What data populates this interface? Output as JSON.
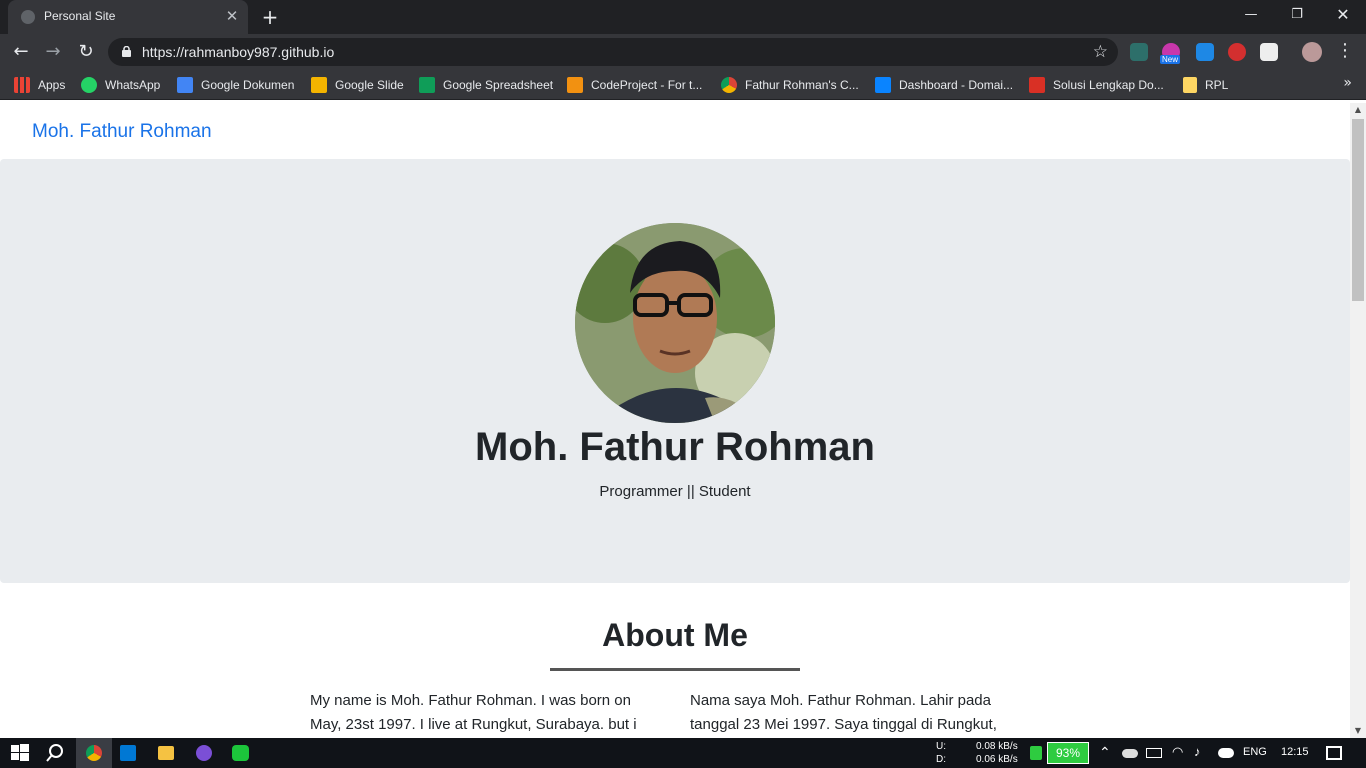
{
  "browser": {
    "tab_title": "Personal Site",
    "url": "https://rahmanboy987.github.io",
    "ext_badge": "New"
  },
  "bookmarks": [
    {
      "label": "Apps",
      "icon": "apps-grid-icon",
      "color": "#ea4335"
    },
    {
      "label": "WhatsApp",
      "icon": "whatsapp-icon",
      "color": "#25d366"
    },
    {
      "label": "Google Dokumen",
      "icon": "google-docs-icon",
      "color": "#4285f4"
    },
    {
      "label": "Google Slide",
      "icon": "google-slides-icon",
      "color": "#f4b400"
    },
    {
      "label": "Google Spreadsheet",
      "icon": "google-sheets-icon",
      "color": "#0f9d58"
    },
    {
      "label": "CodeProject - For t...",
      "icon": "codeproject-icon",
      "color": "#f29111"
    },
    {
      "label": "Fathur Rohman's C...",
      "icon": "chrome-icon",
      "color": "#db4437"
    },
    {
      "label": "Dashboard - Domai...",
      "icon": "domain-icon",
      "color": "#0a84ff"
    },
    {
      "label": "Solusi Lengkap Do...",
      "icon": "solusi-icon",
      "color": "#d93025"
    },
    {
      "label": "RPL",
      "icon": "folder-icon",
      "color": "#fdd663"
    }
  ],
  "site": {
    "brand": "Moh. Fathur Rohman",
    "hero_name": "Moh. Fathur Rohman",
    "hero_subtitle": "Programmer || Student",
    "about_title": "About Me",
    "about_en": "My name is Moh. Fathur Rohman. I was born on May, 23st 1997. I live at Rungkut, Surabaya. but i",
    "about_id": "Nama saya Moh. Fathur Rohman. Lahir pada tanggal 23 Mei 1997. Saya tinggal di Rungkut,"
  },
  "taskbar": {
    "upload_label": "U:",
    "download_label": "D:",
    "upload_speed": "0.08 kB/s",
    "download_speed": "0.06 kB/s",
    "battery": "93%",
    "language": "ENG",
    "time": "12:15"
  },
  "colors": {
    "link": "#1a73e8",
    "hero_bg": "#e9ecef",
    "battery": "#2ecc40"
  }
}
